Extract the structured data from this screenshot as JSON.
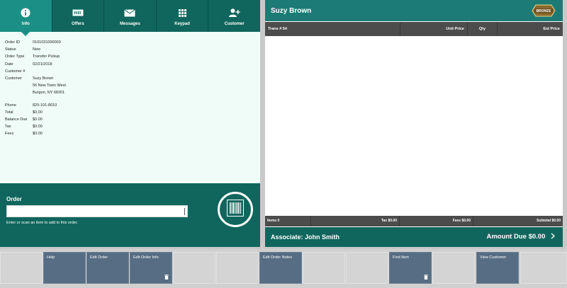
{
  "tabs": [
    {
      "label": "Info",
      "icon": "info-icon",
      "active": true
    },
    {
      "label": "Offers",
      "icon": "offers-icon",
      "active": false
    },
    {
      "label": "Messages",
      "icon": "envelope-icon",
      "active": false
    },
    {
      "label": "Keypad",
      "icon": "keypad-icon",
      "active": false
    },
    {
      "label": "Customer",
      "icon": "add-customer-icon",
      "active": false
    }
  ],
  "order_info": {
    "order_id_label": "Order ID",
    "order_id": "0101031000003",
    "status_label": "Status",
    "status": "New",
    "order_type_label": "Order Type",
    "order_type": "Transfer Pickup",
    "date_label": "Date",
    "date": "02/21/2018",
    "customer_num_label": "Customer #",
    "customer_num": "",
    "customer_label": "Customer",
    "customer_name": "Suzy Brown",
    "address1": "56 New Town West",
    "address2": "Burgon, NY 68201",
    "phone_label": "Phone",
    "phone": "820-101-8010",
    "total_label": "Total",
    "total": "$0.00",
    "balance_due_label": "Balance Due",
    "balance_due": "$0.00",
    "tax_label": "Tax",
    "tax": "$0.00",
    "fees_label": "Fees",
    "fees": "$0.00"
  },
  "order_entry": {
    "title": "Order",
    "input_value": "",
    "hint": "Enter or scan an item to add to this order."
  },
  "transaction": {
    "customer_name": "Suzy Brown",
    "badge": "BRONZE",
    "columns": {
      "trans": "Trans # 54",
      "unit_price": "Unit Price",
      "qty": "Qty",
      "ext_price": "Ext Price"
    },
    "footer": {
      "items": "Items 0",
      "tax": "Tax $0.00",
      "fees": "Fees $0.00",
      "subtotal": "Subtotal $0.00"
    },
    "associate": "Associate: John Smith",
    "amount_due": "Amount Due  $0.00"
  },
  "function_buttons": [
    {
      "label": "",
      "enabled": false,
      "trash": false
    },
    {
      "label": "Help",
      "enabled": true,
      "trash": false
    },
    {
      "label": "Edit Order",
      "enabled": true,
      "trash": false
    },
    {
      "label": "Edit Order Info",
      "enabled": true,
      "trash": true
    },
    {
      "label": "",
      "enabled": false,
      "trash": false
    },
    {
      "label": "",
      "enabled": false,
      "trash": false
    },
    {
      "label": "Edit Order Notes",
      "enabled": true,
      "trash": false
    },
    {
      "label": "",
      "enabled": false,
      "trash": false
    },
    {
      "label": "",
      "enabled": false,
      "trash": false
    },
    {
      "label": "Find Item",
      "enabled": true,
      "trash": true
    },
    {
      "label": "",
      "enabled": false,
      "trash": false
    },
    {
      "label": "View Customer",
      "enabled": true,
      "trash": false
    },
    {
      "label": "",
      "enabled": false,
      "trash": false
    }
  ],
  "colors": {
    "dark_teal": "#10665d",
    "active_tab": "#1b8f85",
    "header_teal": "#1c7b74",
    "button_blue": "#576d83"
  }
}
